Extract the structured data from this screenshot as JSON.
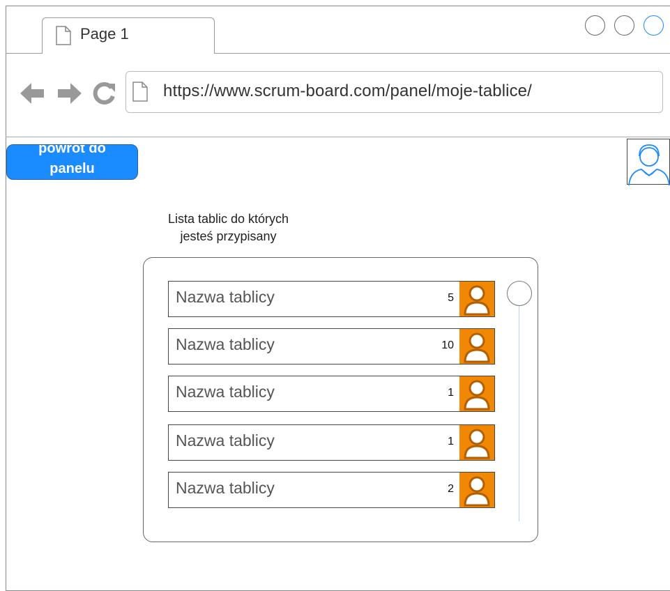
{
  "browser": {
    "tab_title": "Page 1",
    "url": "https://www.scrum-board.com/panel/moje-tablice/",
    "icons": {
      "back": "arrow-left-icon",
      "forward": "arrow-right-icon",
      "reload": "reload-icon",
      "page": "page-icon"
    }
  },
  "header": {
    "back_button_line1": "powrot do",
    "back_button_line2": "panelu",
    "accent_color": "#1a8cff"
  },
  "main": {
    "title_line1": "Lista tablic do których",
    "title_line2": "jesteś przypisany",
    "boards": [
      {
        "name": "Nazwa tablicy",
        "count": "5"
      },
      {
        "name": "Nazwa tablicy",
        "count": "10"
      },
      {
        "name": "Nazwa tablicy",
        "count": "1"
      },
      {
        "name": "Nazwa tablicy",
        "count": "1"
      },
      {
        "name": "Nazwa tablicy",
        "count": "2"
      }
    ],
    "member_icon_color": "#f08705"
  }
}
